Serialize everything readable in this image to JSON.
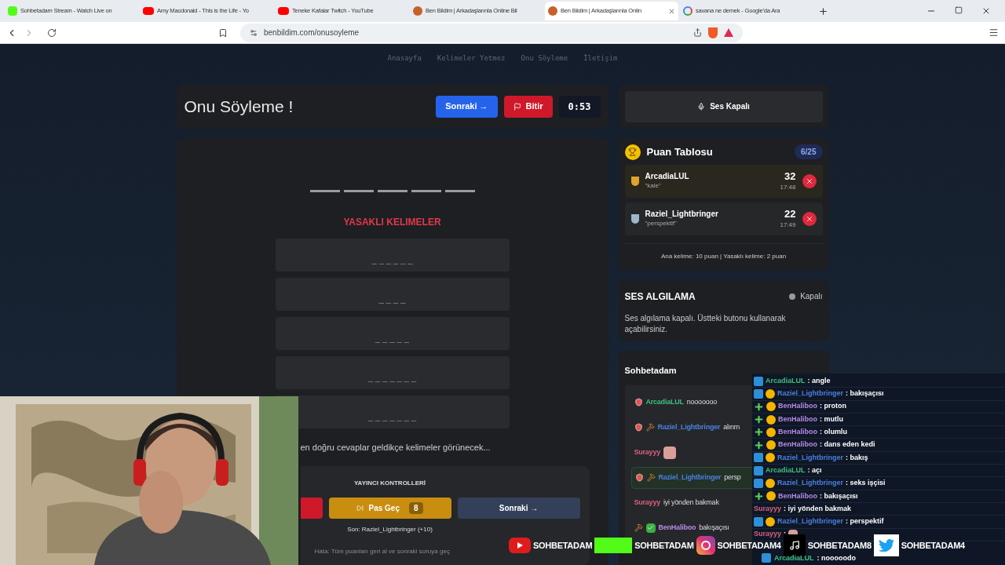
{
  "browser": {
    "tabs": [
      {
        "title": "Sohbetadam Stream - Watch Live on",
        "kind": "kick",
        "selected": false
      },
      {
        "title": "Amy Macdonald - This is the Life - Yo",
        "kind": "youtube",
        "selected": false
      },
      {
        "title": "Teneke Kafalar Twitch - YouTube",
        "kind": "youtube",
        "selected": false
      },
      {
        "title": "Ben Bildim | Arkadaşlarınla Online Bil",
        "kind": "site",
        "selected": false
      },
      {
        "title": "Ben Bildim | Arkadaşlarınla Onlin",
        "kind": "site",
        "selected": true
      },
      {
        "title": "savana ne demek - Google'da Ara",
        "kind": "google",
        "selected": false
      }
    ],
    "url": "benbildim.com/onusoyleme"
  },
  "nav": [
    {
      "label": "Anasayfa"
    },
    {
      "label": "Kelimeler Yetmez"
    },
    {
      "label": "Onu Söyleme"
    },
    {
      "label": "İletişim"
    }
  ],
  "game": {
    "title": "Onu Söyleme !",
    "next_button": "Sonraki →",
    "finish_button": "Bitir",
    "timer": "0:53",
    "forbidden_title": "YASAKLI KELIMELER",
    "forbidden_words": [
      "_ _ _ _ _ _",
      "_ _ _ _",
      "_ _ _ _ _",
      "_ _ _ _ _ _ _",
      "_ _ _ _ _ _ _"
    ],
    "hint": "en doğru cevaplar geldikçe kelimeler görünecek...",
    "controls": {
      "title": "YAYINCI KONTROLLERİ",
      "pass_button": "Pas Geç",
      "pass_count": "8",
      "next_button": "Sonraki →",
      "last": "Son: Raziel_Lightbringer (+10)",
      "note": "Hata: Tüm puanları geri al ve sonraki soruya geç"
    }
  },
  "sound_button": "Ses Kapalı",
  "scoreboard": {
    "title": "Puan Tablosu",
    "progress": "6/25",
    "entries": [
      {
        "name": "ArcadiaLUL",
        "word": "\"kale\"",
        "score": "32",
        "time": "17:48",
        "kind": "gold"
      },
      {
        "name": "Raziel_Lightbringer",
        "word": "\"perspektif\"",
        "score": "22",
        "time": "17:49",
        "kind": "silver"
      }
    ],
    "footer": "Ana kelime: 10 puan | Yasaklı kelime: 2 puan"
  },
  "voice": {
    "title": "SES ALGILAMA",
    "status": "Kapalı",
    "on": false,
    "text": "Ses algılama kapalı. Üstteki butonu kullanarak açabilirsiniz."
  },
  "chat": {
    "title": "Sohbetadam",
    "messages": [
      {
        "user": "ArcadiaLUL",
        "color": "#3fbf7f",
        "badges": [
          {
            "kind": "shield"
          }
        ],
        "kind": "text",
        "text": "nooooooo",
        "highlighted": false
      },
      {
        "user": "Raziel_Lightbringer",
        "color": "#4a80e0",
        "badges": [
          {
            "kind": "shield"
          },
          {
            "kind": "tool"
          }
        ],
        "kind": "text",
        "text": "alınm",
        "highlighted": false
      },
      {
        "user": "Surayyy",
        "color": "#d9607f",
        "kind": "emote",
        "highlighted": false
      },
      {
        "user": "Raziel_Lightbringer",
        "color": "#4a80e0",
        "badges": [
          {
            "kind": "shield"
          },
          {
            "kind": "tool"
          }
        ],
        "kind": "text",
        "text": "persp",
        "highlighted": true
      },
      {
        "user": "Surayyy",
        "color": "#d9607f",
        "kind": "text",
        "text": "iyi yönden bakmak",
        "highlighted": false
      },
      {
        "user": "BenHaliboo",
        "color": "#b48ae6",
        "badges": [
          {
            "kind": "tool"
          },
          {
            "kind": "check"
          }
        ],
        "kind": "text",
        "text": "bakışaçısı",
        "highlighted": false
      }
    ]
  },
  "overlay_chat": [
    {
      "user": "ArcadiaLUL",
      "color": "#3fbf7f",
      "badges": [
        {
          "kind": "mod"
        }
      ],
      "kind": "text",
      "text": ": angle"
    },
    {
      "user": "Raziel_Lightbringer",
      "color": "#4a80e0",
      "badges": [
        {
          "kind": "mod"
        },
        {
          "kind": "sub"
        }
      ],
      "kind": "text",
      "text": ": bakışaçısı"
    },
    {
      "user": "BenHaliboo",
      "color": "#b48ae6",
      "badges": [
        {
          "kind": "vip"
        },
        {
          "kind": "sub"
        }
      ],
      "kind": "text",
      "text": ": proton"
    },
    {
      "user": "BenHaliboo",
      "color": "#b48ae6",
      "badges": [
        {
          "kind": "vip"
        },
        {
          "kind": "sub"
        }
      ],
      "kind": "text",
      "text": ": mutlu"
    },
    {
      "user": "BenHaliboo",
      "color": "#b48ae6",
      "badges": [
        {
          "kind": "vip"
        },
        {
          "kind": "sub"
        }
      ],
      "kind": "text",
      "text": ": olumlu"
    },
    {
      "user": "BenHaliboo",
      "color": "#b48ae6",
      "badges": [
        {
          "kind": "vip"
        },
        {
          "kind": "sub"
        }
      ],
      "kind": "text",
      "text": ": dans eden kedi"
    },
    {
      "user": "Raziel_Lightbringer",
      "color": "#4a80e0",
      "badges": [
        {
          "kind": "mod"
        },
        {
          "kind": "sub"
        }
      ],
      "kind": "text",
      "text": ": bakış"
    },
    {
      "user": "ArcadiaLUL",
      "color": "#3fbf7f",
      "badges": [
        {
          "kind": "mod"
        }
      ],
      "kind": "text",
      "text": ": açı"
    },
    {
      "user": "Raziel_Lightbringer",
      "color": "#4a80e0",
      "badges": [
        {
          "kind": "mod"
        },
        {
          "kind": "sub"
        }
      ],
      "kind": "text",
      "text": ": seks işçisi"
    },
    {
      "user": "BenHaliboo",
      "color": "#b48ae6",
      "badges": [
        {
          "kind": "vip"
        },
        {
          "kind": "sub"
        }
      ],
      "kind": "text",
      "text": ": bakışaçısı"
    },
    {
      "user": "Surayyy",
      "color": "#d9607f",
      "kind": "text",
      "text": ": iyi yönden bakmak"
    },
    {
      "user": "Raziel_Lightbringer",
      "color": "#4a80e0",
      "badges": [
        {
          "kind": "mod"
        },
        {
          "kind": "sub"
        }
      ],
      "kind": "text",
      "text": ": perspektif"
    },
    {
      "user": "Surayyy",
      "color": "#d9607f",
      "kind": "emote",
      "text": ":"
    }
  ],
  "socials": [
    {
      "kind": "youtube",
      "handle": "SOHBETADAM"
    },
    {
      "kind": "kick",
      "handle": "SOHBETADAM"
    },
    {
      "kind": "instagram",
      "handle": "SOHBETADAM4"
    },
    {
      "kind": "tiktok",
      "handle": "SOHBETADAM8"
    },
    {
      "kind": "twitter",
      "handle": "SOHBETADAM4"
    }
  ],
  "last_overlay": {
    "user": "ArcadiaLUL",
    "color": "#3fbf7f",
    "text": ": nooooodo"
  }
}
